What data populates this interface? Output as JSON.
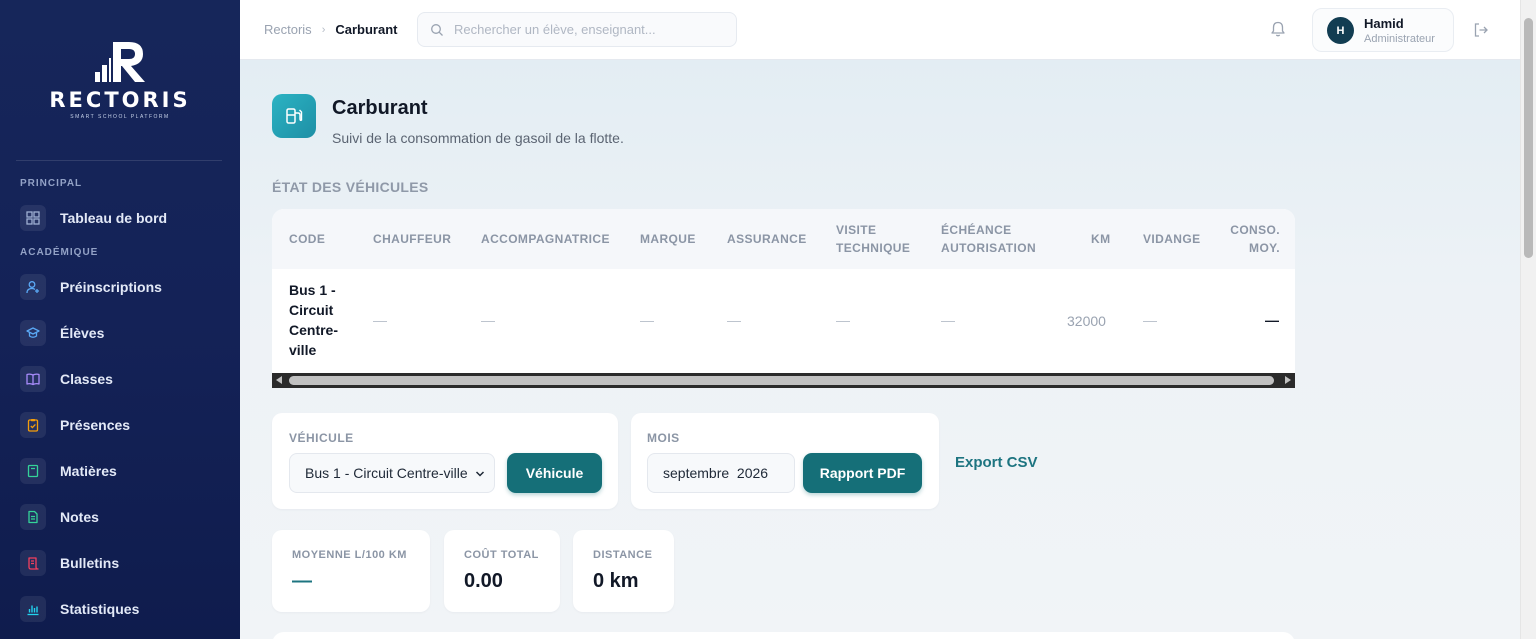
{
  "app": {
    "logo_text": "RECTORIS",
    "logo_subtitle": "SMART SCHOOL PLATFORM"
  },
  "sidebar": {
    "sections": [
      {
        "label": "PRINCIPAL"
      },
      {
        "label": "ACADÉMIQUE"
      }
    ],
    "items": [
      {
        "label": "Tableau de bord",
        "icon": "dashboard-icon",
        "color": "#9fb0d3"
      },
      {
        "label": "Préinscriptions",
        "icon": "user-plus-icon",
        "color": "#5aa9f5"
      },
      {
        "label": "Élèves",
        "icon": "graduation-cap-icon",
        "color": "#5aa9f5"
      },
      {
        "label": "Classes",
        "icon": "book-icon",
        "color": "#a78bfa"
      },
      {
        "label": "Présences",
        "icon": "clipboard-check-icon",
        "color": "#f59e0b"
      },
      {
        "label": "Matières",
        "icon": "notebook-icon",
        "color": "#34d399"
      },
      {
        "label": "Notes",
        "icon": "file-text-icon",
        "color": "#34d399"
      },
      {
        "label": "Bulletins",
        "icon": "scroll-icon",
        "color": "#f43f5e"
      },
      {
        "label": "Statistiques",
        "icon": "bar-chart-icon",
        "color": "#22d3ee"
      }
    ]
  },
  "topbar": {
    "breadcrumb_root": "Rectoris",
    "breadcrumb_current": "Carburant",
    "search_placeholder": "Rechercher un élève, enseignant...",
    "user_initial": "H",
    "user_name": "Hamid",
    "user_role": "Administrateur"
  },
  "page": {
    "title": "Carburant",
    "subtitle": "Suivi de la consommation de gasoil de la flotte.",
    "accent_color": "#156f78"
  },
  "vehicles": {
    "section_title": "ÉTAT DES VÉHICULES",
    "columns": [
      "CODE",
      "CHAUFFEUR",
      "ACCOMPAGNATRICE",
      "MARQUE",
      "ASSURANCE",
      "VISITE TECHNIQUE",
      "ÉCHÉANCE AUTORISATION",
      "KM",
      "VIDANGE",
      "CONSO. MOY."
    ],
    "rows": [
      {
        "code": "Bus 1 - Circuit Centre-ville",
        "chauffeur": "—",
        "accompagnatrice": "—",
        "marque": "—",
        "assurance": "—",
        "visite": "—",
        "echeance": "—",
        "km": "32000",
        "vidange": "—",
        "conso": "—"
      }
    ]
  },
  "filters": {
    "vehicle_label": "VÉHICULE",
    "vehicle_selected": "Bus 1 - Circuit Centre-ville",
    "vehicle_button": "Véhicule",
    "month_label": "MOIS",
    "month_value": "septembre  2026",
    "pdf_button": "Rapport PDF",
    "csv_link": "Export CSV"
  },
  "stats": [
    {
      "label": "MOYENNE L/100 KM",
      "value": "—"
    },
    {
      "label": "COÛT TOTAL",
      "value": "0.00"
    },
    {
      "label": "DISTANCE",
      "value": "0 km"
    }
  ]
}
